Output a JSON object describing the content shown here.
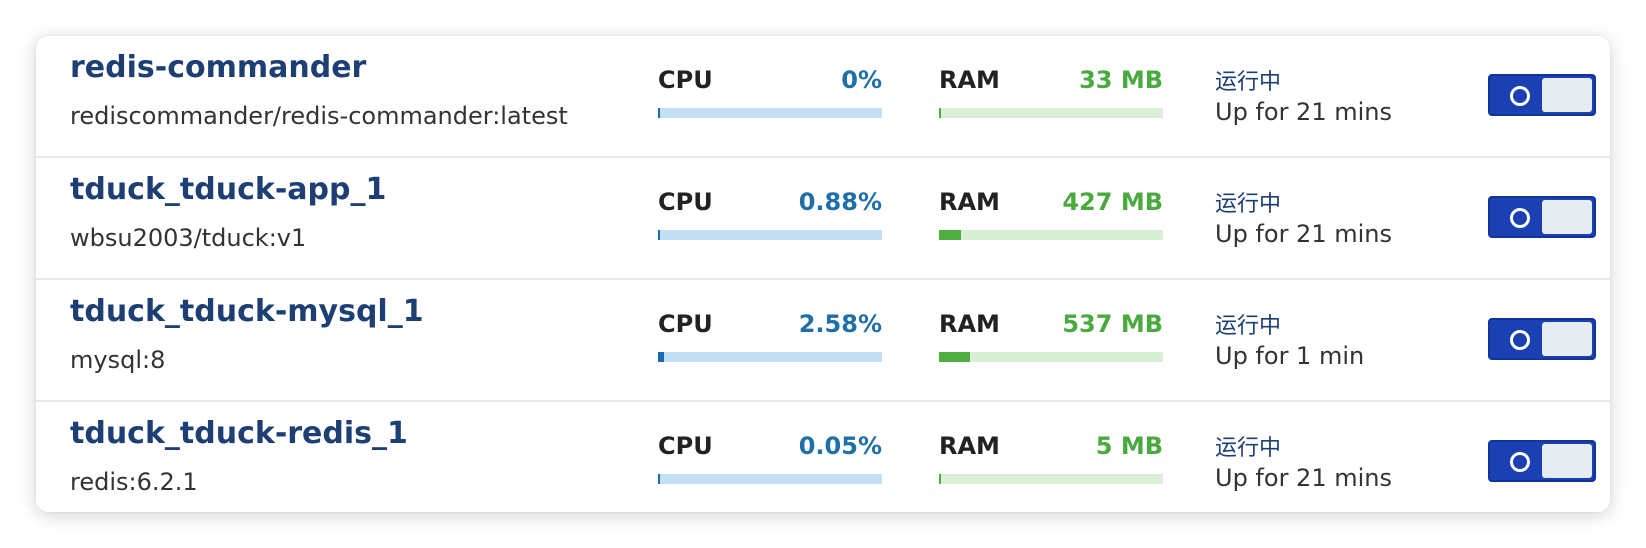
{
  "containers": [
    {
      "name": "redis-commander",
      "image": "rediscommander/redis-commander:latest",
      "cpu_label": "CPU",
      "cpu_value": "0%",
      "cpu_fraction": 0.0,
      "ram_label": "RAM",
      "ram_value": "33 MB",
      "ram_fraction": 0.01,
      "state": "运行中",
      "uptime": "Up for 21 mins",
      "enabled": true
    },
    {
      "name": "tduck_tduck-app_1",
      "image": "wbsu2003/tduck:v1",
      "cpu_label": "CPU",
      "cpu_value": "0.88%",
      "cpu_fraction": 0.01,
      "ram_label": "RAM",
      "ram_value": "427 MB",
      "ram_fraction": 0.1,
      "state": "运行中",
      "uptime": "Up for 21 mins",
      "enabled": true
    },
    {
      "name": "tduck_tduck-mysql_1",
      "image": "mysql:8",
      "cpu_label": "CPU",
      "cpu_value": "2.58%",
      "cpu_fraction": 0.026,
      "ram_label": "RAM",
      "ram_value": "537 MB",
      "ram_fraction": 0.14,
      "state": "运行中",
      "uptime": "Up for 1 min",
      "enabled": true
    },
    {
      "name": "tduck_tduck-redis_1",
      "image": "redis:6.2.1",
      "cpu_label": "CPU",
      "cpu_value": "0.05%",
      "cpu_fraction": 0.0,
      "ram_label": "RAM",
      "ram_value": "5 MB",
      "ram_fraction": 0.01,
      "state": "运行中",
      "uptime": "Up for 21 mins",
      "enabled": true
    }
  ],
  "colors": {
    "name": "#1d3f73",
    "cpu_accent": "#1f6fa8",
    "ram_accent": "#4aaa3f",
    "toggle_on": "#1a40b3"
  },
  "icons": {
    "toggle": "toggle-switch-icon"
  }
}
